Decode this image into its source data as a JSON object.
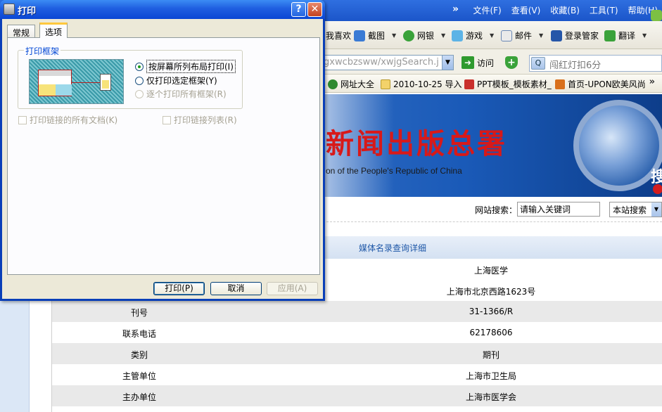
{
  "browser": {
    "menu": {
      "items": [
        "文件(F)",
        "查看(V)",
        "收藏(B)",
        "工具(T)",
        "帮助(H)"
      ],
      "more": "»"
    },
    "toolbar": {
      "fav_partial": "我喜欢",
      "screenshot": "截图",
      "bank": "网银",
      "games": "游戏",
      "mail": "邮件",
      "login_manager": "登录管家",
      "translate": "翻译"
    },
    "address": {
      "url": "gxwcbzsww/xwjgSearch.j",
      "go_label": "访问",
      "search_placeholder": "闯红灯扣6分"
    },
    "favorites": {
      "items": [
        "网址大全",
        "2010-10-25 导入",
        "PPT模板_模板素材_",
        "首页-UPON欧美风尚"
      ],
      "more": "»"
    },
    "banner": {
      "title": "新闻出版总署",
      "subtitle": "on of the People's Republic of China",
      "corner_glyph": "搜"
    },
    "site_search": {
      "label": "网站搜索：",
      "placeholder": "请输入关键词",
      "scope": "本站搜索"
    },
    "detail": {
      "heading": "媒体名录查询详细",
      "rows": [
        {
          "key": "",
          "value": "上海医学"
        },
        {
          "key": "",
          "value": "上海市北京西路1623号"
        },
        {
          "key": "刊号",
          "value": "31-1366/R"
        },
        {
          "key": "联系电话",
          "value": "62178606"
        },
        {
          "key": "类别",
          "value": "期刊"
        },
        {
          "key": "主管单位",
          "value": "上海市卫生局"
        },
        {
          "key": "主办单位",
          "value": "上海市医学会"
        }
      ]
    }
  },
  "dialog": {
    "title": "打印",
    "help_glyph": "?",
    "close_glyph": "✕",
    "tabs": [
      "常规",
      "选项"
    ],
    "frames_group": {
      "legend": "打印框架",
      "options": [
        {
          "label": "按屏幕所列布局打印(I)",
          "checked": true,
          "disabled": false
        },
        {
          "label": "仅打印选定框架(Y)",
          "checked": false,
          "disabled": false
        },
        {
          "label": "逐个打印所有框架(R)",
          "checked": false,
          "disabled": true
        }
      ]
    },
    "checks": {
      "print_links": "打印链接的所有文档(K)",
      "print_link_table": "打印链接列表(R)"
    },
    "buttons": {
      "print": "打印(P)",
      "cancel": "取消",
      "apply": "应用(A)"
    }
  }
}
